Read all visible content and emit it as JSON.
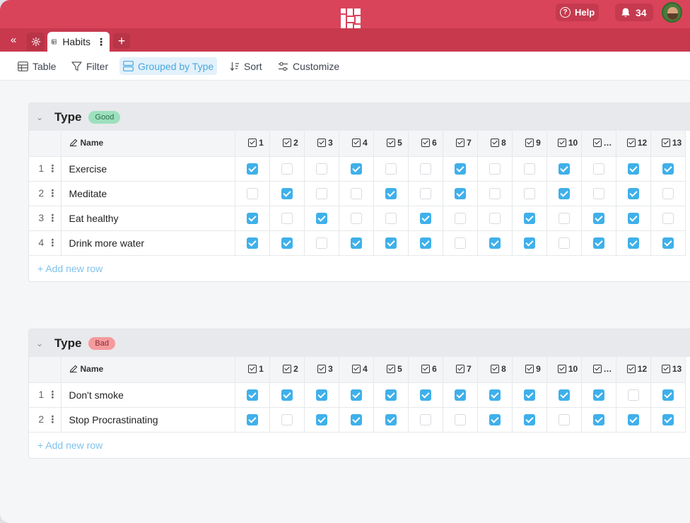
{
  "header": {
    "help_label": "Help",
    "notification_count": "34"
  },
  "tabs": {
    "active_tab": "Habits",
    "add_icon": "plus-icon",
    "collapse_icon": "double-chevron-left-icon",
    "settings_icon": "gear-icon"
  },
  "toolbar": {
    "table_label": "Table",
    "filter_label": "Filter",
    "group_label": "Grouped by Type",
    "sort_label": "Sort",
    "customize_label": "Customize"
  },
  "columns": {
    "name": "Name",
    "days": [
      "1",
      "2",
      "3",
      "4",
      "5",
      "6",
      "7",
      "8",
      "9",
      "10",
      "…",
      "12",
      "13"
    ]
  },
  "groups": [
    {
      "title": "Type",
      "badge": "Good",
      "add_row": "+ Add new row",
      "rows": [
        {
          "index": "1",
          "name": "Exercise",
          "checks": [
            1,
            0,
            0,
            1,
            0,
            0,
            1,
            0,
            0,
            1,
            0,
            1,
            1
          ]
        },
        {
          "index": "2",
          "name": "Meditate",
          "checks": [
            0,
            1,
            0,
            0,
            1,
            0,
            1,
            0,
            0,
            1,
            0,
            1,
            0
          ]
        },
        {
          "index": "3",
          "name": "Eat healthy",
          "checks": [
            1,
            0,
            1,
            0,
            0,
            1,
            0,
            0,
            1,
            0,
            1,
            1,
            0
          ]
        },
        {
          "index": "4",
          "name": "Drink more water",
          "checks": [
            1,
            1,
            0,
            1,
            1,
            1,
            0,
            1,
            1,
            0,
            1,
            1,
            1
          ]
        }
      ]
    },
    {
      "title": "Type",
      "badge": "Bad",
      "add_row": "+ Add new row",
      "rows": [
        {
          "index": "1",
          "name": "Don't smoke",
          "checks": [
            1,
            1,
            1,
            1,
            1,
            1,
            1,
            1,
            1,
            1,
            1,
            0,
            1
          ]
        },
        {
          "index": "2",
          "name": "Stop Procrastinating",
          "checks": [
            1,
            0,
            1,
            1,
            1,
            0,
            0,
            1,
            1,
            0,
            1,
            1,
            1
          ]
        }
      ]
    }
  ],
  "colors": {
    "brand": "#d9445a",
    "tab_bar": "#c8394e",
    "check": "#3fb0ea",
    "good_badge": "#9de0bd",
    "bad_badge": "#f59a9d",
    "active_toolbar": "#4aa8de"
  }
}
